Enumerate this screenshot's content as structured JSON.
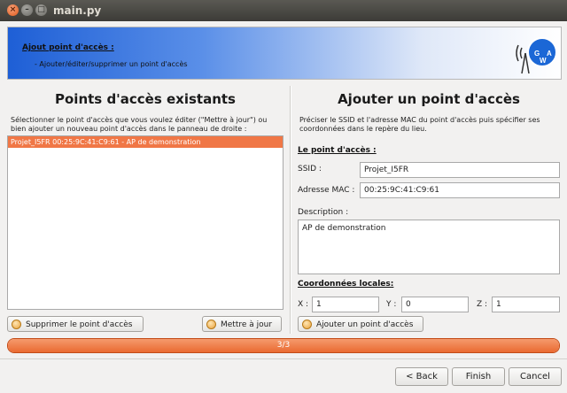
{
  "window": {
    "title": "main.py",
    "close_glyph": "×",
    "minimize_glyph": "–",
    "maximize_glyph": "□"
  },
  "banner": {
    "title": "Ajout point d'accès :",
    "subtitle": "- Ajouter/éditer/supprimer un point d'accès",
    "logo_letters": [
      "G",
      "W",
      "A"
    ]
  },
  "left_panel": {
    "title": "Points d'accès existants",
    "instructions_line1": "Sélectionner le point d'accès que vous voulez éditer (\"Mettre à jour\") ou",
    "instructions_line2": "bien ajouter un nouveau point d'accès dans le panneau de droite :",
    "list_items": [
      "Projet_I5FR 00:25:9C:41:C9:61 - AP de demonstration"
    ],
    "delete_button": "Supprimer le point d'accès",
    "update_button": "Mettre à jour"
  },
  "right_panel": {
    "title": "Ajouter un point d'accès",
    "instructions_line1": "Préciser le SSID et l'adresse MAC du point d'accès puis spécifier ses",
    "instructions_line2": "coordonnées dans le repère du lieu.",
    "section_ap": "Le point d'accès :",
    "ssid_label": "SSID :",
    "ssid_value": "Projet_I5FR",
    "mac_label": "Adresse MAC :",
    "mac_value": "00:25:9C:41:C9:61",
    "description_label": "Description :",
    "description_value": "AP de demonstration",
    "section_coords": "Coordonnées locales:",
    "x_label": "X :",
    "x_value": "1",
    "y_label": "Y :",
    "y_value": "0",
    "z_label": "Z :",
    "z_value": "1",
    "add_button": "Ajouter un point d'accès"
  },
  "progress": {
    "label": "3/3",
    "fraction": 1.0
  },
  "nav": {
    "back": "< Back",
    "finish": "Finish",
    "cancel": "Cancel"
  },
  "colors": {
    "accent": "#f07746",
    "banner_blue": "#1e5fd6"
  }
}
